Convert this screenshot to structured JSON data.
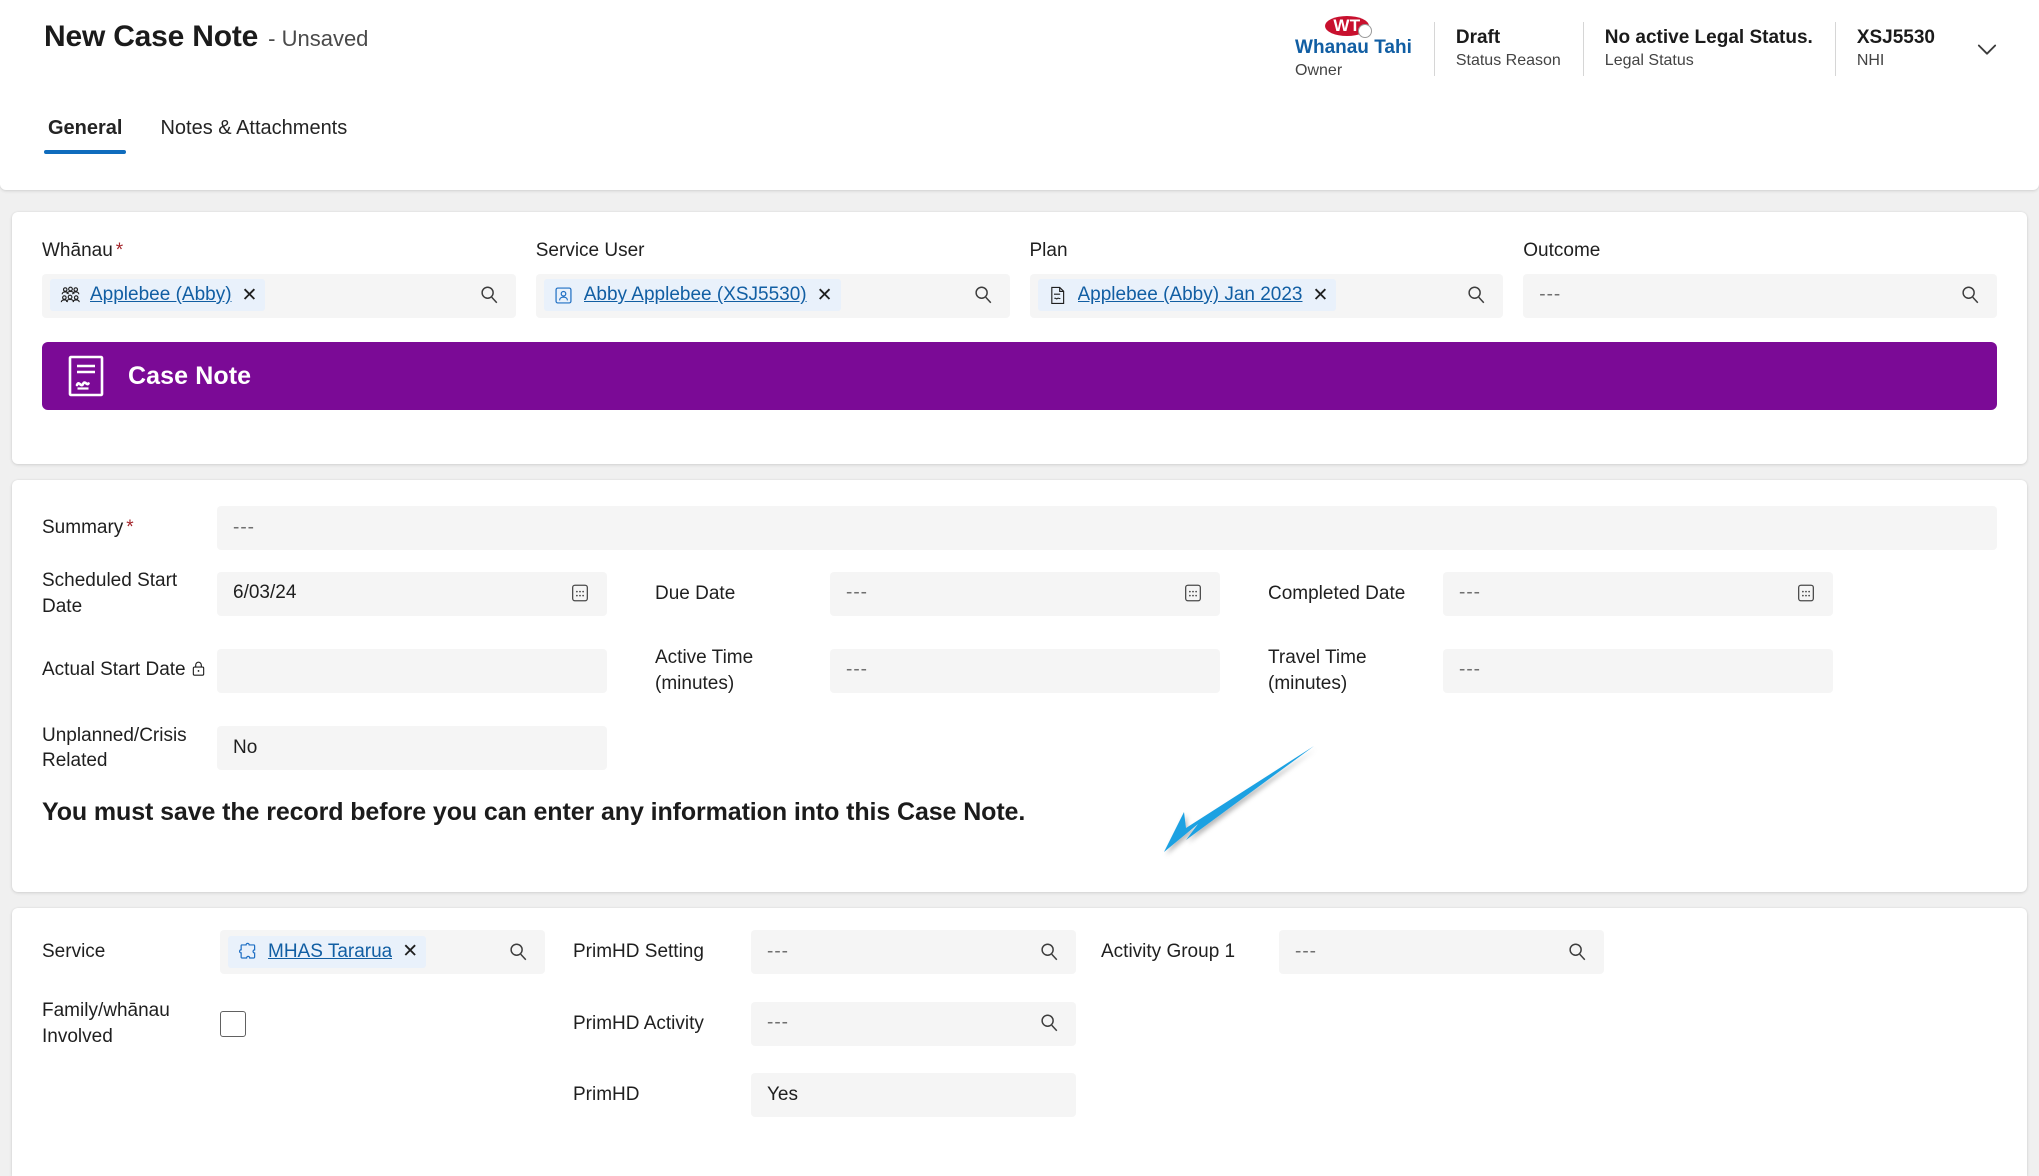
{
  "header": {
    "title": "New Case Note",
    "subtitle": "- Unsaved",
    "tabs": [
      {
        "label": "General",
        "active": true
      },
      {
        "label": "Notes & Attachments",
        "active": false
      }
    ],
    "owner": {
      "initials": "WT",
      "name": "Whanau Tahi",
      "role": "Owner",
      "avatar_color": "#c8102e"
    },
    "status_cells": [
      {
        "top": "Draft",
        "bottom": "Status Reason"
      },
      {
        "top": "No active Legal Status.",
        "bottom": "Legal Status"
      },
      {
        "top": "XSJ5530",
        "bottom": "NHI"
      }
    ],
    "expand_icon": "chevron-down-icon"
  },
  "lookups": [
    {
      "label": "Whānau",
      "required": true,
      "token": {
        "text": "Applebee (Abby)",
        "icon": "people-group-icon"
      },
      "placeholder": "",
      "action_icon": "search-icon"
    },
    {
      "label": "Service User",
      "required": false,
      "token": {
        "text": "Abby Applebee (XSJ5530)",
        "icon": "contact-card-icon"
      },
      "placeholder": "",
      "action_icon": "search-icon"
    },
    {
      "label": "Plan",
      "required": false,
      "token": {
        "text": "Applebee (Abby) Jan 2023",
        "icon": "document-plan-icon"
      },
      "placeholder": "",
      "action_icon": "search-icon"
    },
    {
      "label": "Outcome",
      "required": false,
      "token": null,
      "placeholder": "---",
      "action_icon": "search-icon"
    }
  ],
  "banner": {
    "title": "Case Note",
    "icon": "case-note-signature-icon",
    "color": "#7b0a96"
  },
  "detail": {
    "summary": {
      "label": "Summary",
      "required": true,
      "value": "---"
    },
    "fields": [
      {
        "label": "Scheduled Start Date",
        "value": "6/03/24",
        "icon": "calendar-icon",
        "locked": false
      },
      {
        "label": "Due Date",
        "value": "---",
        "icon": "calendar-icon",
        "locked": false
      },
      {
        "label": "Completed Date",
        "value": "---",
        "icon": "calendar-icon",
        "locked": false
      },
      {
        "label": "Actual Start Date",
        "value": "",
        "icon": "",
        "locked": true
      },
      {
        "label": "Active Time (minutes)",
        "value": "---",
        "icon": "",
        "locked": false
      },
      {
        "label": "Travel Time (minutes)",
        "value": "---",
        "icon": "",
        "locked": false
      },
      {
        "label": "Unplanned/Crisis Related",
        "value": "No",
        "icon": "",
        "locked": false
      }
    ],
    "warning": "You must save the record before you can enter any information into this Case Note.",
    "annotation": {
      "type": "arrow",
      "color": "#1ba1e2"
    }
  },
  "service": {
    "service_label": "Service",
    "service_token": {
      "text": "MHAS Tararua",
      "icon": "puzzle-piece-icon"
    },
    "family_label": "Family/whānau Involved",
    "family_checked": false,
    "primhd_setting": {
      "label": "PrimHD Setting",
      "value": "---",
      "icon": "search-icon"
    },
    "primhd_activity": {
      "label": "PrimHD Activity",
      "value": "---",
      "icon": "search-icon"
    },
    "primhd": {
      "label": "PrimHD",
      "value": "Yes"
    },
    "activity_group": {
      "label": "Activity Group 1",
      "value": "---",
      "icon": "search-icon"
    }
  }
}
